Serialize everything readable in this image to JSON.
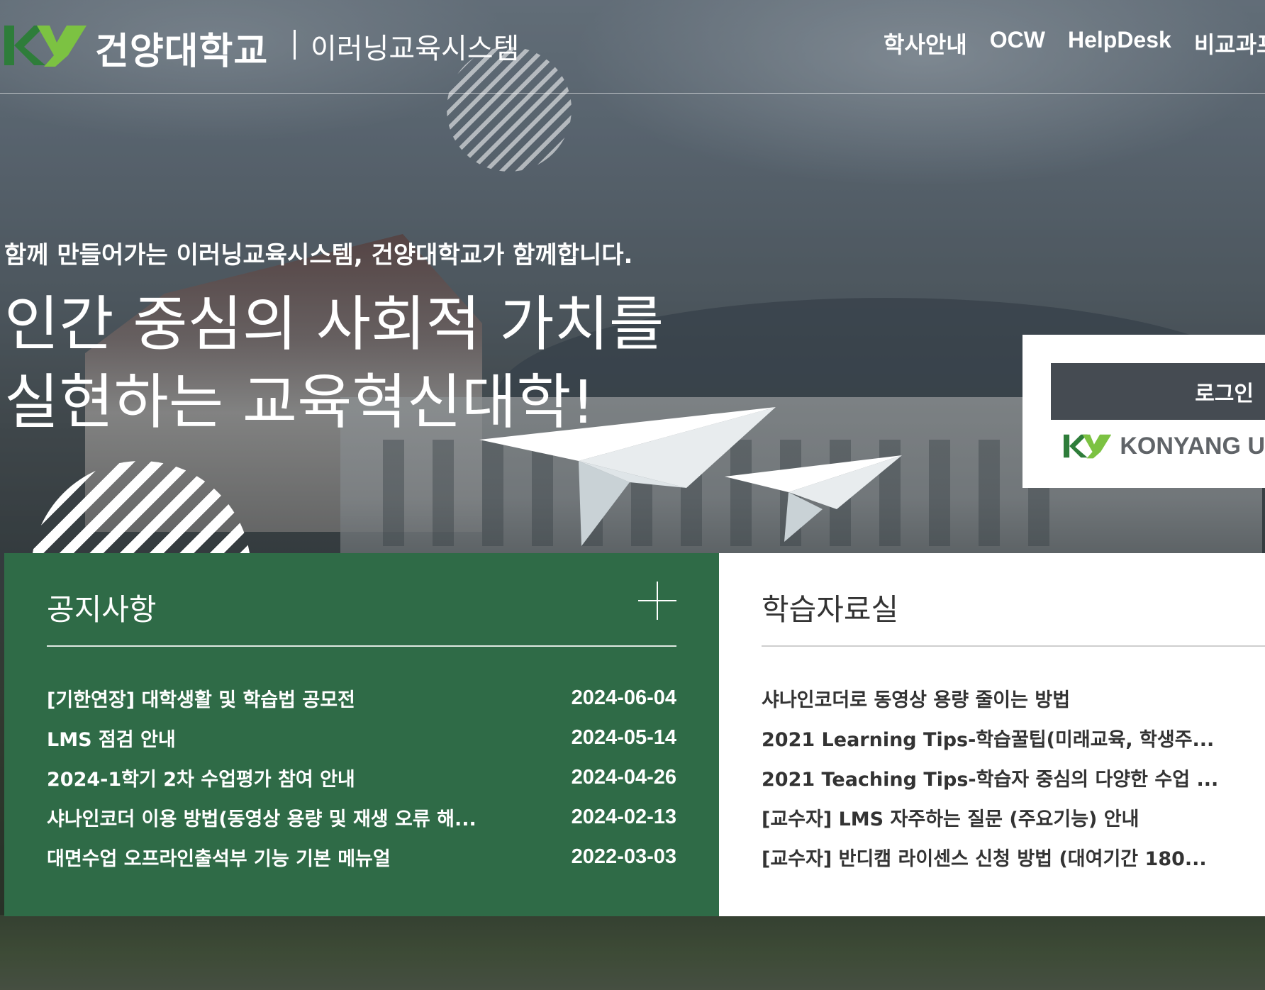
{
  "header": {
    "university_name": "건양대학교",
    "system_name": "이러닝교육시스템",
    "nav": [
      "학사안내",
      "OCW",
      "HelpDesk",
      "비교과프"
    ]
  },
  "hero": {
    "subtitle": "함께 만들어가는 이러닝교육시스템, 건양대학교가 함께합니다.",
    "title": "인간 중심의 사회적 가치를\n실현하는 교육혁신대학!"
  },
  "login": {
    "button_label": "로그인",
    "logo_text": "KONYANG U"
  },
  "notices": {
    "title": "공지사항",
    "items": [
      {
        "title": "[기한연장] 대학생활 및 학습법 공모전",
        "date": "2024-06-04"
      },
      {
        "title": "LMS 점검 안내",
        "date": "2024-05-14"
      },
      {
        "title": "2024-1학기 2차 수업평가 참여 안내",
        "date": "2024-04-26"
      },
      {
        "title": "샤나인코더 이용 방법(동영상 용량 및 재생 오류 해...",
        "date": "2024-02-13"
      },
      {
        "title": "대면수업 오프라인출석부 기능 기본 메뉴얼",
        "date": "2022-03-03"
      }
    ]
  },
  "resources": {
    "title": "학습자료실",
    "items": [
      {
        "title": "샤나인코더로 동영상 용량 줄이는 방법"
      },
      {
        "title": "2021 Learning Tips-학습꿀팁(미래교육, 학생주..."
      },
      {
        "title": "2021 Teaching Tips-학습자 중심의 다양한 수업 ..."
      },
      {
        "title": "[교수자] LMS 자주하는 질문 (주요기능) 안내"
      },
      {
        "title": "[교수자] 반디캠 라이센스 신청 방법 (대여기간 180..."
      }
    ]
  },
  "colors": {
    "brand_green": "#2f6b47",
    "logo_dark_green": "#2e7d3a",
    "logo_light_green": "#7cc242",
    "login_button": "#454b52"
  }
}
